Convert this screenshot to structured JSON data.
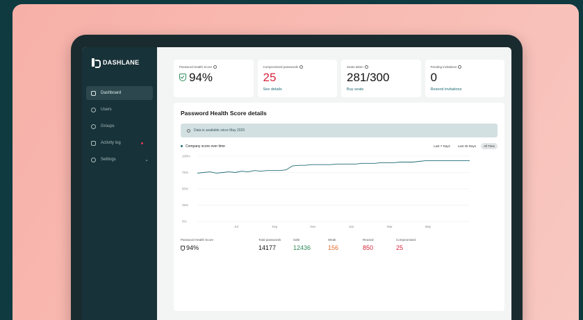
{
  "brand": {
    "name": "DASHLANE"
  },
  "sidebar": {
    "items": [
      {
        "label": "Dashboard",
        "icon": "dashboard-icon",
        "active": true
      },
      {
        "label": "Users",
        "icon": "users-icon"
      },
      {
        "label": "Groups",
        "icon": "groups-icon"
      },
      {
        "label": "Activity log",
        "icon": "activity-log-icon",
        "badge": "red-dot"
      },
      {
        "label": "Settings",
        "icon": "settings-icon",
        "expandable": true
      }
    ]
  },
  "stats": [
    {
      "label": "Password Health Score",
      "value": "94%",
      "icon": "shield-check-icon"
    },
    {
      "label": "Compromised passwords",
      "value": "25",
      "link": "See details",
      "color": "#d7263d"
    },
    {
      "label": "Seats taken",
      "value": "281/300",
      "link": "Buy seats"
    },
    {
      "label": "Pending invitations",
      "value": "0",
      "link": "Resend invitations"
    }
  ],
  "details": {
    "title": "Password Health Score details",
    "banner": "Data is available since May 2020",
    "legend": "Company score over time",
    "filters": [
      "Last 7 Days",
      "Last 30 Days",
      "All Time"
    ],
    "active_filter": "All Time"
  },
  "chart_data": {
    "type": "line",
    "series": [
      {
        "name": "Company score over time",
        "values": [
          74,
          75,
          76,
          74,
          75,
          76,
          75,
          77,
          76,
          78,
          77,
          78,
          78,
          78,
          79,
          85,
          86,
          86,
          87,
          87,
          87,
          87,
          88,
          88,
          88,
          88,
          89,
          89,
          89,
          90,
          90,
          90,
          91,
          91,
          91,
          92,
          93,
          93,
          93,
          93,
          93,
          93,
          93,
          93
        ]
      }
    ],
    "yticks": [
      "100%",
      "75%",
      "50%",
      "25%",
      "0%"
    ],
    "ylim": [
      0,
      100
    ],
    "xticks": [
      "Jul",
      "Sep",
      "Nov",
      "Jan",
      "Mar",
      "May"
    ],
    "grid": true,
    "color": "#1e6a74"
  },
  "summary": {
    "score_label": "Password Health Score",
    "score_value": "94%",
    "total_label": "Total passwords",
    "total_value": "14177",
    "safe_label": "Safe",
    "safe_value": "12436",
    "weak_label": "Weak",
    "weak_value": "156",
    "reused_label": "Reused",
    "reused_value": "850",
    "compromised_label": "Compromised",
    "compromised_value": "25"
  }
}
